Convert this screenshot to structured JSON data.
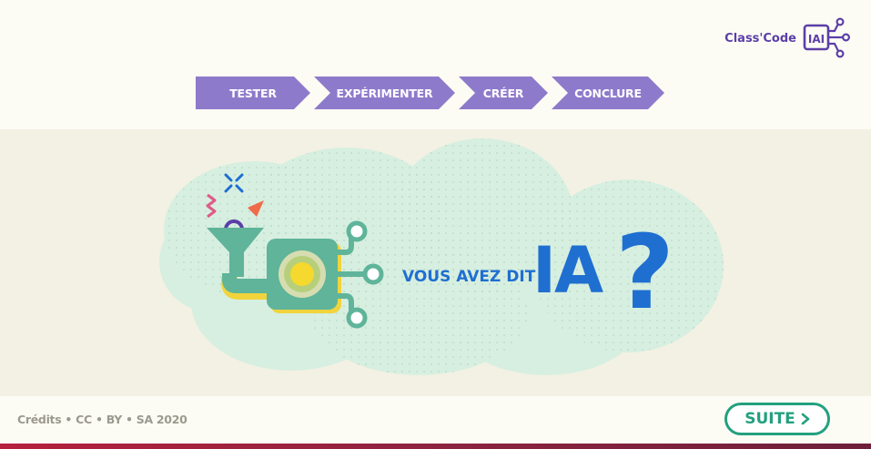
{
  "logo": {
    "text": "Class'Code",
    "badge": "IAI",
    "icon": "circuit-icon"
  },
  "steps": [
    {
      "label": "TESTER"
    },
    {
      "label": "EXPÉRIMENTER"
    },
    {
      "label": "CRÉER"
    },
    {
      "label": "CONCLURE"
    }
  ],
  "banner": {
    "subtitle": "VOUS AVEZ DIT",
    "title": "IA",
    "mark": "?"
  },
  "footer": {
    "credits": "Crédits • CC • BY • SA 2020",
    "next_label": "SUITE",
    "next_icon": "chevron-right-icon"
  },
  "colors": {
    "accent_purple": "#8e7acb",
    "logo_purple": "#5b3fa8",
    "green": "#23a07f",
    "blue": "#1f6fd1",
    "cloud": "#d7efe0"
  }
}
